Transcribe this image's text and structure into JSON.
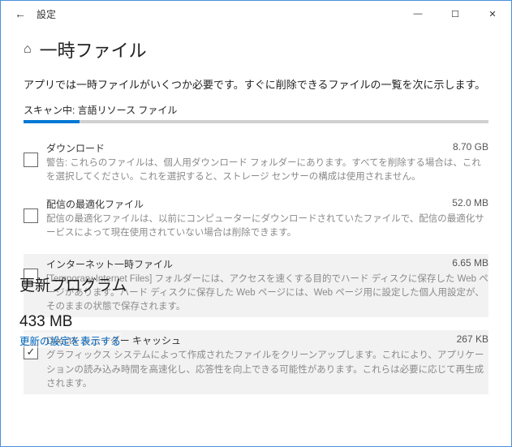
{
  "window": {
    "title": "設定"
  },
  "page": {
    "title": "一時ファイル",
    "intro": "アプリでは一時ファイルがいくつか必要です。すぐに削除できるファイルの一覧を次に示します。",
    "scan_label": "スキャン中: 言語リソース ファイル"
  },
  "items": [
    {
      "name": "ダウンロード",
      "size": "8.70 GB",
      "desc": "警告: これらのファイルは、個人用ダウンロード フォルダーにあります。すべてを削除する場合は、これを選択してください。これを選択すると、ストレージ センサーの構成は使用されません。",
      "checked": false
    },
    {
      "name": "配信の最適化ファイル",
      "size": "52.0 MB",
      "desc": "配信の最適化ファイルは、以前にコンピューターにダウンロードされていたファイルで、配信の最適化サービスによって現在使用されていない場合は削除できます。",
      "checked": false
    },
    {
      "name": "インターネット一時ファイル",
      "size": "6.65 MB",
      "desc": "[Temporary Internet Files] フォルダーには、アクセスを速くする目的でハード ディスクに保存した Web ページがあります。ハード ディスクに保存した Web ページには、Web ページ用に設定した個人用設定が、そのままの状態で保存されます。",
      "checked": false
    },
    {
      "name": "DirectX シェーダー キャッシュ",
      "size": "267 KB",
      "desc": "グラフィックス システムによって作成されたファイルをクリーンアップします。これにより、アプリケーションの読み込み時間を高速化し、応答性を向上できる可能性があります。これらは必要に応じて再生成されます。",
      "checked": true
    }
  ],
  "overlay": {
    "title": "更新プログラム",
    "size": "433 MB",
    "link": "更新の設定を表示する"
  }
}
